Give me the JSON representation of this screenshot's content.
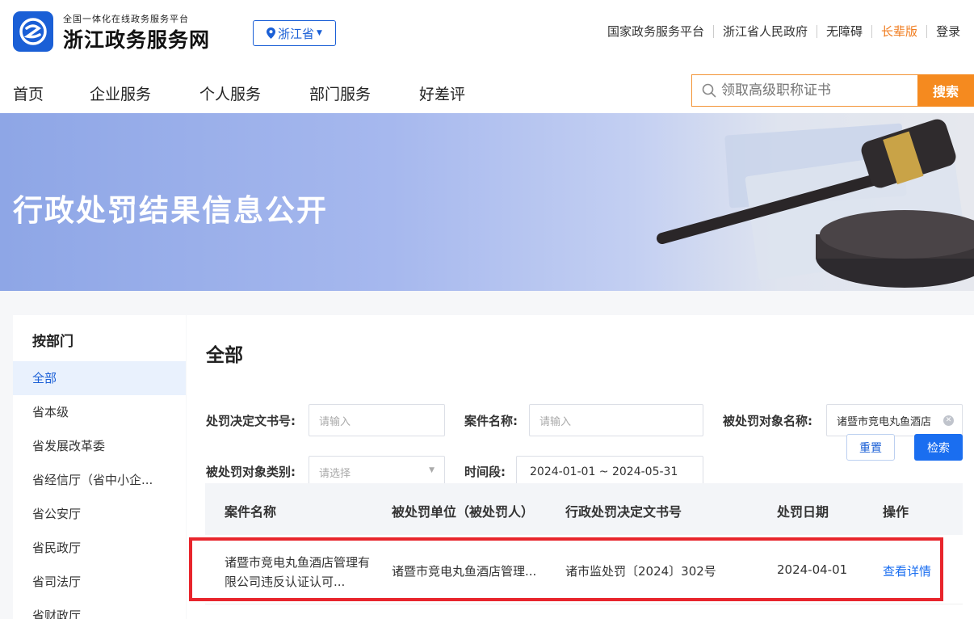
{
  "header": {
    "brand_sub": "全国一体化在线政务服务平台",
    "brand_main": "浙江政务服务网",
    "region": "浙江省",
    "top_links": [
      "国家政务服务平台",
      "浙江省人民政府",
      "无障碍",
      "长辈版",
      "登录"
    ]
  },
  "nav": {
    "items": [
      "首页",
      "企业服务",
      "个人服务",
      "部门服务",
      "好差评"
    ],
    "search_placeholder": "领取高级职称证书",
    "search_button": "搜索"
  },
  "banner": {
    "title": "行政处罚结果信息公开"
  },
  "sidebar": {
    "heading": "按部门",
    "items": [
      "全部",
      "省本级",
      "省发展改革委",
      "省经信厅（省中小企...",
      "省公安厅",
      "省民政厅",
      "省司法厅",
      "省财政厅"
    ]
  },
  "main": {
    "title": "全部",
    "filters": {
      "doc_no_label": "处罚决定文书号:",
      "doc_no_placeholder": "请输入",
      "case_name_label": "案件名称:",
      "case_name_placeholder": "请输入",
      "target_name_label": "被处罚对象名称:",
      "target_name_value": "诸暨市竞电丸鱼酒店",
      "target_type_label": "被处罚对象类别:",
      "target_type_placeholder": "请选择",
      "period_label": "时间段:",
      "period_value": "2024-01-01 ~ 2024-05-31",
      "reset_button": "重置",
      "search_button": "检索"
    },
    "table": {
      "columns": [
        "案件名称",
        "被处罚单位（被处罚人）",
        "行政处罚决定文书号",
        "处罚日期",
        "操作"
      ],
      "rows": [
        {
          "case_name": "诸暨市竞电丸鱼酒店管理有限公司违反认证认可...",
          "unit": "诸暨市竞电丸鱼酒店管理...",
          "doc_no": "诸市监处罚〔2024〕302号",
          "date": "2024-04-01",
          "action": "查看详情"
        }
      ]
    }
  },
  "colors": {
    "brand_blue": "#1a5fd6",
    "accent_orange": "#f58a1f",
    "highlight_red": "#e8252c"
  }
}
